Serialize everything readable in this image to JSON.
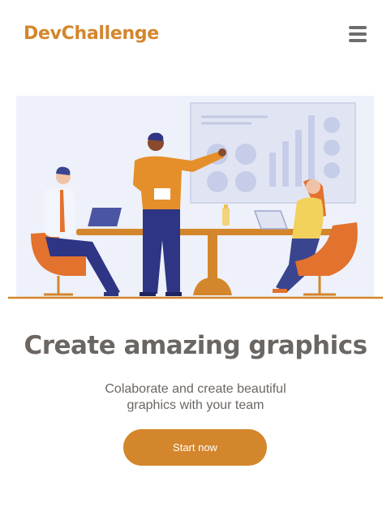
{
  "header": {
    "logo": "DevChallenge",
    "menu_icon": "hamburger-menu-icon"
  },
  "hero": {
    "title": "Create amazing graphics",
    "subtitle": "Colaborate and create beautiful graphics with your team",
    "cta_label": "Start now"
  },
  "colors": {
    "accent": "#d4862c",
    "text": "#6b6662",
    "illustration_bg": "#eef1fa"
  }
}
